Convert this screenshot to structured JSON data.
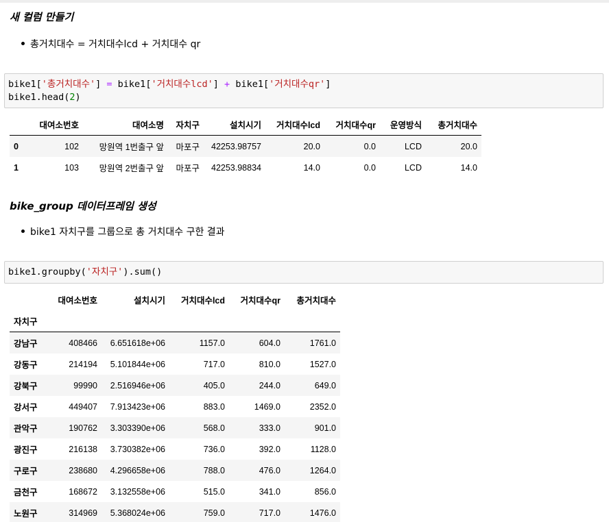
{
  "section1": {
    "heading": "새 컬럼 만들기",
    "bullet": "총거치대수 = 거치대수lcd + 거치대수 qr"
  },
  "code1": {
    "line1": {
      "p1": "bike1[",
      "s1": "'총거치대수'",
      "p2": "] ",
      "op1": "=",
      "p3": " bike1[",
      "s2": "'거치대수lcd'",
      "p4": "] ",
      "op2": "+",
      "p5": " bike1[",
      "s3": "'거치대수qr'",
      "p6": "]"
    },
    "line2": {
      "p1": "bike1.head(",
      "n1": "2",
      "p2": ")"
    }
  },
  "table1": {
    "columns": [
      "",
      "대여소번호",
      "대여소명",
      "자치구",
      "설치시기",
      "거치대수lcd",
      "거치대수qr",
      "운영방식",
      "총거치대수"
    ],
    "rows": [
      [
        "0",
        "102",
        "망원역 1번출구 앞",
        "마포구",
        "42253.98757",
        "20.0",
        "0.0",
        "LCD",
        "20.0"
      ],
      [
        "1",
        "103",
        "망원역 2번출구 앞",
        "마포구",
        "42253.98834",
        "14.0",
        "0.0",
        "LCD",
        "14.0"
      ]
    ]
  },
  "section2": {
    "heading_code": "bike_group",
    "heading_rest": " 데이터프레임 생성",
    "bullet": "bike1 자치구를 그룹으로 총 거치대수 구한 결과"
  },
  "code2": {
    "p1": "bike1.groupby(",
    "s1": "'자치구'",
    "p2": ").sum()"
  },
  "table2": {
    "columns": [
      "",
      "대여소번호",
      "설치시기",
      "거치대수lcd",
      "거치대수qr",
      "총거치대수"
    ],
    "index_name": "자치구",
    "rows": [
      [
        "강남구",
        "408466",
        "6.651618e+06",
        "1157.0",
        "604.0",
        "1761.0"
      ],
      [
        "강동구",
        "214194",
        "5.101844e+06",
        "717.0",
        "810.0",
        "1527.0"
      ],
      [
        "강북구",
        "99990",
        "2.516946e+06",
        "405.0",
        "244.0",
        "649.0"
      ],
      [
        "강서구",
        "449407",
        "7.913423e+06",
        "883.0",
        "1469.0",
        "2352.0"
      ],
      [
        "관악구",
        "190762",
        "3.303390e+06",
        "568.0",
        "333.0",
        "901.0"
      ],
      [
        "광진구",
        "216138",
        "3.730382e+06",
        "736.0",
        "392.0",
        "1128.0"
      ],
      [
        "구로구",
        "238680",
        "4.296658e+06",
        "788.0",
        "476.0",
        "1264.0"
      ],
      [
        "금천구",
        "168672",
        "3.132558e+06",
        "515.0",
        "341.0",
        "856.0"
      ],
      [
        "노원구",
        "314969",
        "5.368024e+06",
        "759.0",
        "717.0",
        "1476.0"
      ]
    ]
  },
  "colors": {
    "string": "#ba2121",
    "operator": "#aa22ff",
    "number": "#008000",
    "code_bg": "#f7f7f7",
    "stripe": "#f5f5f5"
  }
}
